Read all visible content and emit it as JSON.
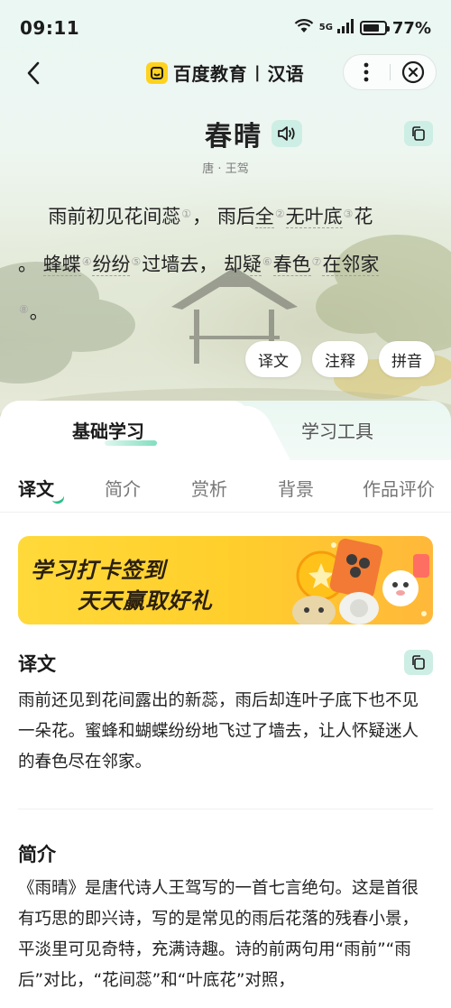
{
  "status_bar": {
    "time": "09:11",
    "network": "5G",
    "battery_text": "77%",
    "battery_level": 0.77
  },
  "nav": {
    "brand_name": "百度教育",
    "separator": "|",
    "brand_sub": "汉语"
  },
  "poem": {
    "title": "春晴",
    "author": "唐 · 王驾",
    "line1": {
      "a": "雨前初见花间蕊",
      "n1": "①",
      "b": "，  雨后",
      "c": "全",
      "n2": "②",
      "d": "无叶底",
      "n3": "③",
      "e": "花"
    },
    "line2": {
      "a": "。 ",
      "b": "蜂蝶",
      "n4": "④",
      "c": "纷纷",
      "n5": "⑤",
      "d": "过墙去，  ",
      "e": "却疑",
      "n6": "⑥",
      "f": "春色",
      "n7": "⑦",
      "g": "在邻家"
    },
    "line3": {
      "n8": "⑧",
      "a": "。"
    },
    "buttons": [
      "译文",
      "注释",
      "拼音"
    ]
  },
  "main_tabs": {
    "active": "基础学习",
    "inactive": "学习工具"
  },
  "sub_tabs": [
    "译文",
    "简介",
    "赏析",
    "背景",
    "作品评价"
  ],
  "banner": {
    "line1": "学习打卡签到",
    "line2": "天天赢取好礼"
  },
  "translation": {
    "title": "译文",
    "text": "雨前还见到花间露出的新蕊，雨后却连叶子底下也不见一朵花。蜜蜂和蝴蝶纷纷地飞过了墙去，让人怀疑迷人的春色尽在邻家。"
  },
  "intro": {
    "title": "简介",
    "text": "《雨晴》是唐代诗人王驾写的一首七言绝句。这是首很有巧思的即兴诗，写的是常见的雨后花落的残春小景，平淡里可见奇特，充满诗趣。诗的前两句用“雨前”“雨后”对比，“花间蕊”和“叶底花”对照，"
  },
  "colors": {
    "accent": "#2fbf8a",
    "accent_soft": "#cdeee4",
    "banner_yellow": "#ffd93a",
    "brand_yellow": "#ffd21f"
  }
}
